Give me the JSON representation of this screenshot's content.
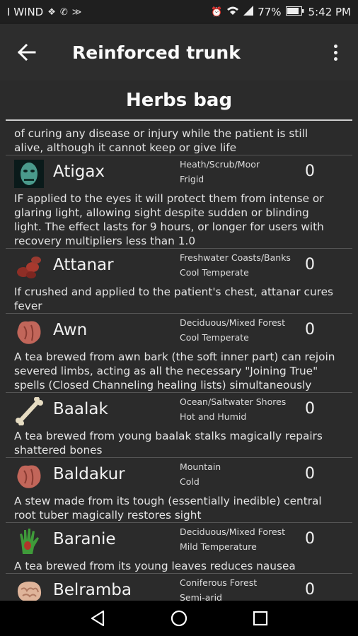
{
  "status_bar": {
    "carrier": "I WIND",
    "battery": "77%",
    "time": "5:42 PM",
    "icons": [
      "dropbox-icon",
      "whatsapp-icon",
      "cast-icon",
      "alarm-icon",
      "wifi-icon",
      "signal-icon",
      "battery-icon"
    ]
  },
  "app_bar": {
    "title": "Reinforced trunk",
    "back_icon": "arrow-back-icon",
    "menu_icon": "more-vert-icon"
  },
  "section": {
    "title": "Herbs bag"
  },
  "continued_description": "of curing any disease or injury while the patient is still alive, although it cannot keep or give life",
  "herbs": [
    {
      "name": "Atigax",
      "habitat": "Heath/Scrub/Moor",
      "climate": "Frigid",
      "count": "0",
      "icon": "green-monster-head-icon",
      "description": "IF applied to the eyes it will protect them from intense or glaring light, allowing sight despite sudden or blinding light. The effect lasts for 9 hours, or longer for users with recovery multipliers less than 1.0"
    },
    {
      "name": "Attanar",
      "habitat": "Freshwater Coasts/Banks",
      "climate": "Cool Temperate",
      "count": "0",
      "icon": "red-meat-pieces-icon",
      "description": "If crushed and applied to the patient's chest, attanar cures fever"
    },
    {
      "name": "Awn",
      "habitat": "Deciduous/Mixed Forest",
      "climate": "Cool Temperate",
      "count": "0",
      "icon": "organ-icon",
      "description": "A tea brewed from awn bark (the soft inner part) can rejoin severed limbs, acting as all the necessary \"Joining True\" spells (Closed Channeling healing lists) simultaneously"
    },
    {
      "name": "Baalak",
      "habitat": "Ocean/Saltwater Shores",
      "climate": "Hot and Humid",
      "count": "0",
      "icon": "bone-icon",
      "description": "A tea brewed from young baalak stalks magically repairs shattered bones"
    },
    {
      "name": "Baldakur",
      "habitat": "Mountain",
      "climate": "Cold",
      "count": "0",
      "icon": "organ-icon",
      "description": "A stew made from its tough (essentially inedible) central root tuber magically restores sight"
    },
    {
      "name": "Baranie",
      "habitat": "Deciduous/Mixed Forest",
      "climate": "Mild Temperature",
      "count": "0",
      "icon": "green-hand-icon",
      "description": "A tea brewed from its young leaves reduces nausea"
    },
    {
      "name": "Belramba",
      "habitat": "Coniferous Forest",
      "climate": "Semi-arid",
      "count": "0",
      "icon": "brain-icon",
      "description": ""
    }
  ],
  "nav_bar": {
    "back": "nav-back-icon",
    "home": "nav-home-icon",
    "recents": "nav-recents-icon"
  }
}
